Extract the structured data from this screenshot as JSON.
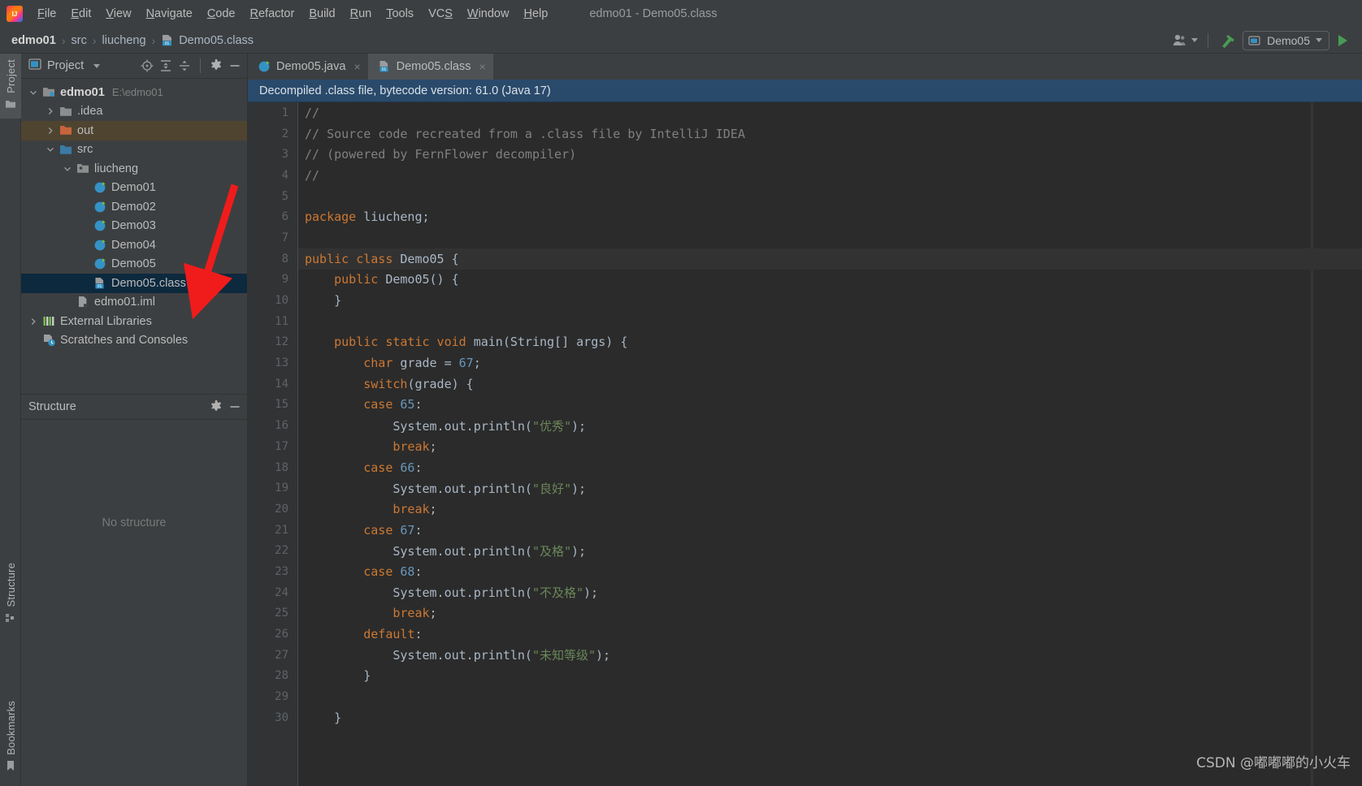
{
  "window": {
    "title": "edmo01 - Demo05.class",
    "logo_icon": "intellij-idea-logo"
  },
  "menubar": {
    "items": [
      {
        "label": "File",
        "mnemonic": "F"
      },
      {
        "label": "Edit",
        "mnemonic": "E"
      },
      {
        "label": "View",
        "mnemonic": "V"
      },
      {
        "label": "Navigate",
        "mnemonic": "N"
      },
      {
        "label": "Code",
        "mnemonic": "C"
      },
      {
        "label": "Refactor",
        "mnemonic": "R"
      },
      {
        "label": "Build",
        "mnemonic": "B"
      },
      {
        "label": "Run",
        "mnemonic": "R"
      },
      {
        "label": "Tools",
        "mnemonic": "T"
      },
      {
        "label": "VCS",
        "mnemonic": "S"
      },
      {
        "label": "Window",
        "mnemonic": "W"
      },
      {
        "label": "Help",
        "mnemonic": "H"
      }
    ]
  },
  "navbar": {
    "crumbs": [
      {
        "label": "edmo01",
        "icon": null
      },
      {
        "label": "src",
        "icon": null
      },
      {
        "label": "liucheng",
        "icon": null
      },
      {
        "label": "Demo05.class",
        "icon": "class-file-icon"
      }
    ],
    "separator": "›",
    "actions": {
      "user_icon": "user-account-icon",
      "build_icon": "build-hammer-icon",
      "run_config": "Demo05",
      "run_config_icon": "run-config-icon",
      "run_icon": "run-play-icon"
    }
  },
  "rail": {
    "tabs": [
      {
        "label": "Project",
        "icon": "project-folder-icon",
        "active": true
      },
      {
        "label": "Structure",
        "icon": "structure-icon",
        "active": false
      },
      {
        "label": "Bookmarks",
        "icon": "bookmark-icon",
        "active": false
      }
    ]
  },
  "project_panel": {
    "title": "Project",
    "title_icon": "project-view-icon",
    "actions": [
      {
        "icon": "chevron-down-icon",
        "name": "view-mode-dropdown"
      },
      {
        "icon": "locate-target-icon",
        "name": "select-opened-file"
      },
      {
        "icon": "expand-all-icon",
        "name": "expand-all"
      },
      {
        "icon": "collapse-all-icon",
        "name": "collapse-all"
      },
      {
        "icon": "gear-icon",
        "name": "panel-settings"
      },
      {
        "icon": "minimize-icon",
        "name": "hide-panel"
      }
    ],
    "tree": [
      {
        "label": "edmo01",
        "secondary": "E:\\edmo01",
        "indent": 0,
        "twisty": "expanded",
        "icon": "module-folder-icon",
        "bold": true,
        "state": "normal"
      },
      {
        "label": ".idea",
        "secondary": "",
        "indent": 1,
        "twisty": "collapsed",
        "icon": "folder-icon",
        "bold": false,
        "state": "normal"
      },
      {
        "label": "out",
        "secondary": "",
        "indent": 1,
        "twisty": "collapsed",
        "icon": "folder-orange-icon",
        "bold": false,
        "state": "output"
      },
      {
        "label": "src",
        "secondary": "",
        "indent": 1,
        "twisty": "expanded",
        "icon": "folder-blue-icon",
        "bold": false,
        "state": "normal"
      },
      {
        "label": "liucheng",
        "secondary": "",
        "indent": 2,
        "twisty": "expanded",
        "icon": "package-icon",
        "bold": false,
        "state": "normal"
      },
      {
        "label": "Demo01",
        "secondary": "",
        "indent": 3,
        "twisty": "none",
        "icon": "java-class-runnable-icon",
        "bold": false,
        "state": "normal"
      },
      {
        "label": "Demo02",
        "secondary": "",
        "indent": 3,
        "twisty": "none",
        "icon": "java-class-runnable-icon",
        "bold": false,
        "state": "normal"
      },
      {
        "label": "Demo03",
        "secondary": "",
        "indent": 3,
        "twisty": "none",
        "icon": "java-class-runnable-icon",
        "bold": false,
        "state": "normal"
      },
      {
        "label": "Demo04",
        "secondary": "",
        "indent": 3,
        "twisty": "none",
        "icon": "java-class-runnable-icon",
        "bold": false,
        "state": "normal"
      },
      {
        "label": "Demo05",
        "secondary": "",
        "indent": 3,
        "twisty": "none",
        "icon": "java-class-runnable-icon",
        "bold": false,
        "state": "normal"
      },
      {
        "label": "Demo05.class",
        "secondary": "",
        "indent": 3,
        "twisty": "none",
        "icon": "class-file-icon",
        "bold": false,
        "state": "selected"
      },
      {
        "label": "edmo01.iml",
        "secondary": "",
        "indent": 2,
        "twisty": "none",
        "icon": "iml-file-icon",
        "bold": false,
        "state": "normal"
      },
      {
        "label": "External Libraries",
        "secondary": "",
        "indent": 0,
        "twisty": "collapsed",
        "icon": "libraries-icon",
        "bold": false,
        "state": "normal"
      },
      {
        "label": "Scratches and Consoles",
        "secondary": "",
        "indent": 0,
        "twisty": "none",
        "icon": "scratches-icon",
        "bold": false,
        "state": "normal"
      }
    ]
  },
  "structure_panel": {
    "title": "Structure",
    "empty_text": "No structure",
    "actions": [
      {
        "icon": "gear-icon",
        "name": "structure-settings"
      },
      {
        "icon": "minimize-icon",
        "name": "hide-structure"
      }
    ]
  },
  "editor": {
    "tabs": [
      {
        "label": "Demo05.java",
        "icon": "java-class-runnable-icon",
        "active": false,
        "close": "×"
      },
      {
        "label": "Demo05.class",
        "icon": "class-file-icon",
        "active": true,
        "close": "×"
      }
    ],
    "notification": "Decompiled .class file, bytecode version: 61.0 (Java 17)",
    "current_line": 8,
    "lines": [
      {
        "n": 1,
        "tokens": [
          {
            "t": "//",
            "c": "cm"
          }
        ]
      },
      {
        "n": 2,
        "tokens": [
          {
            "t": "// Source code recreated from a .class file by IntelliJ IDEA",
            "c": "cm"
          }
        ]
      },
      {
        "n": 3,
        "tokens": [
          {
            "t": "// (powered by FernFlower decompiler)",
            "c": "cm"
          }
        ]
      },
      {
        "n": 4,
        "tokens": [
          {
            "t": "//",
            "c": "cm"
          }
        ]
      },
      {
        "n": 5,
        "tokens": []
      },
      {
        "n": 6,
        "tokens": [
          {
            "t": "package",
            "c": "k"
          },
          {
            "t": " liucheng;",
            "c": "ty"
          }
        ]
      },
      {
        "n": 7,
        "tokens": []
      },
      {
        "n": 8,
        "tokens": [
          {
            "t": "public class",
            "c": "k"
          },
          {
            "t": " Demo05 {",
            "c": "ty"
          }
        ]
      },
      {
        "n": 9,
        "tokens": [
          {
            "t": "    ",
            "c": "ty"
          },
          {
            "t": "public",
            "c": "k"
          },
          {
            "t": " Demo05() {",
            "c": "ty"
          }
        ]
      },
      {
        "n": 10,
        "tokens": [
          {
            "t": "    }",
            "c": "ty"
          }
        ]
      },
      {
        "n": 11,
        "tokens": []
      },
      {
        "n": 12,
        "tokens": [
          {
            "t": "    ",
            "c": "ty"
          },
          {
            "t": "public static void",
            "c": "k"
          },
          {
            "t": " main(String[] args) {",
            "c": "ty"
          }
        ]
      },
      {
        "n": 13,
        "tokens": [
          {
            "t": "        ",
            "c": "ty"
          },
          {
            "t": "char",
            "c": "k"
          },
          {
            "t": " grade = ",
            "c": "ty"
          },
          {
            "t": "67",
            "c": "num"
          },
          {
            "t": ";",
            "c": "ty"
          }
        ]
      },
      {
        "n": 14,
        "tokens": [
          {
            "t": "        ",
            "c": "ty"
          },
          {
            "t": "switch",
            "c": "k"
          },
          {
            "t": "(grade) {",
            "c": "ty"
          }
        ]
      },
      {
        "n": 15,
        "tokens": [
          {
            "t": "        ",
            "c": "ty"
          },
          {
            "t": "case",
            "c": "k"
          },
          {
            "t": " ",
            "c": "ty"
          },
          {
            "t": "65",
            "c": "num"
          },
          {
            "t": ":",
            "c": "ty"
          }
        ]
      },
      {
        "n": 16,
        "tokens": [
          {
            "t": "            System.out.println(",
            "c": "ty"
          },
          {
            "t": "\"优秀\"",
            "c": "st"
          },
          {
            "t": ");",
            "c": "ty"
          }
        ]
      },
      {
        "n": 17,
        "tokens": [
          {
            "t": "            ",
            "c": "ty"
          },
          {
            "t": "break",
            "c": "k"
          },
          {
            "t": ";",
            "c": "ty"
          }
        ]
      },
      {
        "n": 18,
        "tokens": [
          {
            "t": "        ",
            "c": "ty"
          },
          {
            "t": "case",
            "c": "k"
          },
          {
            "t": " ",
            "c": "ty"
          },
          {
            "t": "66",
            "c": "num"
          },
          {
            "t": ":",
            "c": "ty"
          }
        ]
      },
      {
        "n": 19,
        "tokens": [
          {
            "t": "            System.out.println(",
            "c": "ty"
          },
          {
            "t": "\"良好\"",
            "c": "st"
          },
          {
            "t": ");",
            "c": "ty"
          }
        ]
      },
      {
        "n": 20,
        "tokens": [
          {
            "t": "            ",
            "c": "ty"
          },
          {
            "t": "break",
            "c": "k"
          },
          {
            "t": ";",
            "c": "ty"
          }
        ]
      },
      {
        "n": 21,
        "tokens": [
          {
            "t": "        ",
            "c": "ty"
          },
          {
            "t": "case",
            "c": "k"
          },
          {
            "t": " ",
            "c": "ty"
          },
          {
            "t": "67",
            "c": "num"
          },
          {
            "t": ":",
            "c": "ty"
          }
        ]
      },
      {
        "n": 22,
        "tokens": [
          {
            "t": "            System.out.println(",
            "c": "ty"
          },
          {
            "t": "\"及格\"",
            "c": "st"
          },
          {
            "t": ");",
            "c": "ty"
          }
        ]
      },
      {
        "n": 23,
        "tokens": [
          {
            "t": "        ",
            "c": "ty"
          },
          {
            "t": "case",
            "c": "k"
          },
          {
            "t": " ",
            "c": "ty"
          },
          {
            "t": "68",
            "c": "num"
          },
          {
            "t": ":",
            "c": "ty"
          }
        ]
      },
      {
        "n": 24,
        "tokens": [
          {
            "t": "            System.out.println(",
            "c": "ty"
          },
          {
            "t": "\"不及格\"",
            "c": "st"
          },
          {
            "t": ");",
            "c": "ty"
          }
        ]
      },
      {
        "n": 25,
        "tokens": [
          {
            "t": "            ",
            "c": "ty"
          },
          {
            "t": "break",
            "c": "k"
          },
          {
            "t": ";",
            "c": "ty"
          }
        ]
      },
      {
        "n": 26,
        "tokens": [
          {
            "t": "        ",
            "c": "ty"
          },
          {
            "t": "default",
            "c": "k"
          },
          {
            "t": ":",
            "c": "ty"
          }
        ]
      },
      {
        "n": 27,
        "tokens": [
          {
            "t": "            System.out.println(",
            "c": "ty"
          },
          {
            "t": "\"未知等级\"",
            "c": "st"
          },
          {
            "t": ");",
            "c": "ty"
          }
        ]
      },
      {
        "n": 28,
        "tokens": [
          {
            "t": "        }",
            "c": "ty"
          }
        ]
      },
      {
        "n": 29,
        "tokens": []
      },
      {
        "n": 30,
        "tokens": [
          {
            "t": "    }",
            "c": "ty"
          }
        ]
      }
    ]
  },
  "annotation": {
    "arrow": "red-pointer-arrow",
    "target": "Demo05.class tree node"
  },
  "watermark": "CSDN @嘟嘟嘟的小火车",
  "colors": {
    "chrome": "#3c3f41",
    "editor_bg": "#2b2b2b",
    "gutter_bg": "#313335",
    "selection": "#0d293e",
    "notification": "#2a4a6b",
    "output_folder": "#4f4430",
    "text": "#bbbbbb",
    "code_text": "#a9b7c6",
    "keyword": "#cc7832",
    "string": "#6a8759",
    "number": "#6897bb",
    "comment": "#808080",
    "accent_run": "#499c54",
    "arrow_red": "#f01c1c"
  }
}
